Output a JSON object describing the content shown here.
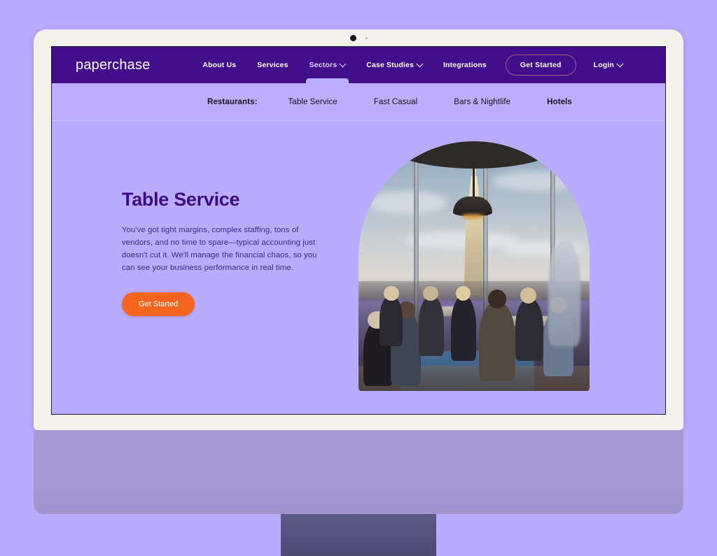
{
  "device": {
    "camera_icon": "camera-dot",
    "sensor_icon": "sensor-dot"
  },
  "site": {
    "logo": "paperchase",
    "nav": [
      {
        "label": "About Us",
        "has_caret": false,
        "active": false
      },
      {
        "label": "Services",
        "has_caret": false,
        "active": false
      },
      {
        "label": "Sectors",
        "has_caret": true,
        "active": true
      },
      {
        "label": "Case Studies",
        "has_caret": true,
        "active": false
      },
      {
        "label": "Integrations",
        "has_caret": false,
        "active": false
      }
    ],
    "cta_label": "Get Started",
    "login": {
      "label": "Login",
      "has_caret": true
    }
  },
  "subnav": {
    "group_label": "Restaurants:",
    "items": [
      {
        "label": "Table Service",
        "bold": false
      },
      {
        "label": "Fast Casual",
        "bold": false
      },
      {
        "label": "Bars & Nightlife",
        "bold": false
      },
      {
        "label": "Hotels",
        "bold": true
      }
    ]
  },
  "hero": {
    "title": "Table Service",
    "description": "You've got tight margins, complex staffing, tons of vendors, and no time to spare—typical accounting just doesn't cut it. We'll manage the financial chaos, so you can see your business performance in real time.",
    "cta_label": "Get Started",
    "image_alt": "restaurant-dining-room-city-view"
  },
  "colors": {
    "nav_purple": "#410d8a",
    "page_lavender": "#b9abfd",
    "subnav_lavender": "#bcaefd",
    "heading_purple": "#3d0c84",
    "body_purple": "#3b2a8c",
    "cta_orange": "#f4661f",
    "bezel_white": "#f4f2ed",
    "chin_purple": "#a79ad4",
    "stand_gray": "#5c5a86"
  }
}
